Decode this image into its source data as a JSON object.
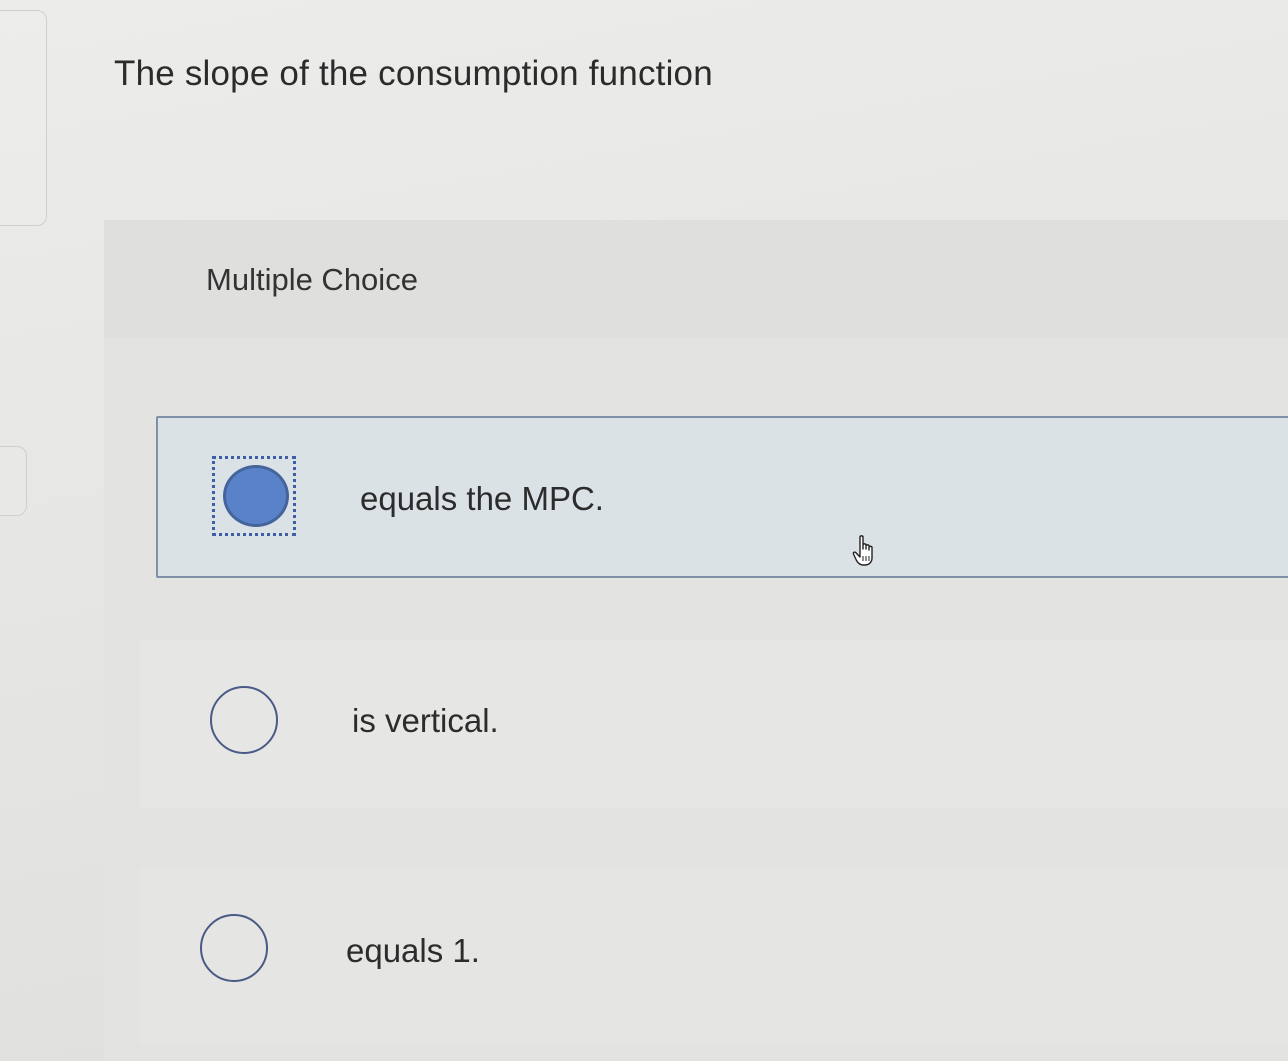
{
  "question": {
    "text": "The slope of the consumption function"
  },
  "panel": {
    "type_label": "Multiple Choice"
  },
  "choices": [
    {
      "label": "equals the MPC.",
      "selected": true
    },
    {
      "label": "is vertical.",
      "selected": false
    },
    {
      "label": "equals 1.",
      "selected": false
    }
  ],
  "colors": {
    "accent": "#5a82c8",
    "selected_background": "#dbe2e6",
    "selected_border": "#8090a8",
    "radio_outline": "#4a5a86"
  },
  "icons": {
    "cursor": "hand-pointer-icon",
    "radio_selected": "radio-selected-icon",
    "radio_unselected": "radio-unselected-icon"
  }
}
